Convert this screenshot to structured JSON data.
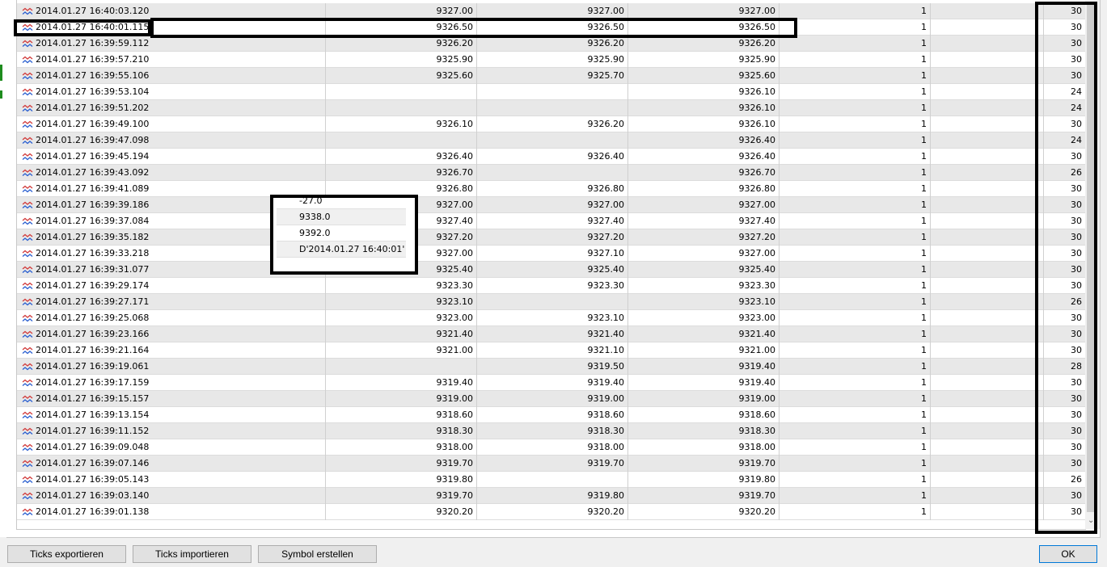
{
  "colors": {
    "row_alt": "#e8e8e8",
    "row_base": "#ffffff",
    "highlight_border": "#000000",
    "ok_border": "#0078d7",
    "tick_icon_red": "#d23c3c",
    "tick_icon_blue": "#2a5fd0"
  },
  "tick_icon": "tick-wave-icon",
  "ticks": [
    {
      "time": "2014.01.27 16:40:03.120",
      "bid": "9327.00",
      "ask": "9327.00",
      "last": "9327.00",
      "volume": "1",
      "flags": "30"
    },
    {
      "time": "2014.01.27 16:40:01.115",
      "bid": "9326.50",
      "ask": "9326.50",
      "last": "9326.50",
      "volume": "1",
      "flags": "30"
    },
    {
      "time": "2014.01.27 16:39:59.112",
      "bid": "9326.20",
      "ask": "9326.20",
      "last": "9326.20",
      "volume": "1",
      "flags": "30"
    },
    {
      "time": "2014.01.27 16:39:57.210",
      "bid": "9325.90",
      "ask": "9325.90",
      "last": "9325.90",
      "volume": "1",
      "flags": "30"
    },
    {
      "time": "2014.01.27 16:39:55.106",
      "bid": "9325.60",
      "ask": "9325.70",
      "last": "9325.60",
      "volume": "1",
      "flags": "30"
    },
    {
      "time": "2014.01.27 16:39:53.104",
      "bid": "",
      "ask": "",
      "last": "9326.10",
      "volume": "1",
      "flags": "24"
    },
    {
      "time": "2014.01.27 16:39:51.202",
      "bid": "",
      "ask": "",
      "last": "9326.10",
      "volume": "1",
      "flags": "24"
    },
    {
      "time": "2014.01.27 16:39:49.100",
      "bid": "9326.10",
      "ask": "9326.20",
      "last": "9326.10",
      "volume": "1",
      "flags": "30"
    },
    {
      "time": "2014.01.27 16:39:47.098",
      "bid": "",
      "ask": "",
      "last": "9326.40",
      "volume": "1",
      "flags": "24"
    },
    {
      "time": "2014.01.27 16:39:45.194",
      "bid": "9326.40",
      "ask": "9326.40",
      "last": "9326.40",
      "volume": "1",
      "flags": "30"
    },
    {
      "time": "2014.01.27 16:39:43.092",
      "bid": "9326.70",
      "ask": "",
      "last": "9326.70",
      "volume": "1",
      "flags": "26"
    },
    {
      "time": "2014.01.27 16:39:41.089",
      "bid": "9326.80",
      "ask": "9326.80",
      "last": "9326.80",
      "volume": "1",
      "flags": "30"
    },
    {
      "time": "2014.01.27 16:39:39.186",
      "bid": "9327.00",
      "ask": "9327.00",
      "last": "9327.00",
      "volume": "1",
      "flags": "30"
    },
    {
      "time": "2014.01.27 16:39:37.084",
      "bid": "9327.40",
      "ask": "9327.40",
      "last": "9327.40",
      "volume": "1",
      "flags": "30"
    },
    {
      "time": "2014.01.27 16:39:35.182",
      "bid": "9327.20",
      "ask": "9327.20",
      "last": "9327.20",
      "volume": "1",
      "flags": "30"
    },
    {
      "time": "2014.01.27 16:39:33.218",
      "bid": "9327.00",
      "ask": "9327.10",
      "last": "9327.00",
      "volume": "1",
      "flags": "30"
    },
    {
      "time": "2014.01.27 16:39:31.077",
      "bid": "9325.40",
      "ask": "9325.40",
      "last": "9325.40",
      "volume": "1",
      "flags": "30"
    },
    {
      "time": "2014.01.27 16:39:29.174",
      "bid": "9323.30",
      "ask": "9323.30",
      "last": "9323.30",
      "volume": "1",
      "flags": "30"
    },
    {
      "time": "2014.01.27 16:39:27.171",
      "bid": "9323.10",
      "ask": "",
      "last": "9323.10",
      "volume": "1",
      "flags": "26"
    },
    {
      "time": "2014.01.27 16:39:25.068",
      "bid": "9323.00",
      "ask": "9323.10",
      "last": "9323.00",
      "volume": "1",
      "flags": "30"
    },
    {
      "time": "2014.01.27 16:39:23.166",
      "bid": "9321.40",
      "ask": "9321.40",
      "last": "9321.40",
      "volume": "1",
      "flags": "30"
    },
    {
      "time": "2014.01.27 16:39:21.164",
      "bid": "9321.00",
      "ask": "9321.10",
      "last": "9321.00",
      "volume": "1",
      "flags": "30"
    },
    {
      "time": "2014.01.27 16:39:19.061",
      "bid": "",
      "ask": "9319.50",
      "last": "9319.40",
      "volume": "1",
      "flags": "28"
    },
    {
      "time": "2014.01.27 16:39:17.159",
      "bid": "9319.40",
      "ask": "9319.40",
      "last": "9319.40",
      "volume": "1",
      "flags": "30"
    },
    {
      "time": "2014.01.27 16:39:15.157",
      "bid": "9319.00",
      "ask": "9319.00",
      "last": "9319.00",
      "volume": "1",
      "flags": "30"
    },
    {
      "time": "2014.01.27 16:39:13.154",
      "bid": "9318.60",
      "ask": "9318.60",
      "last": "9318.60",
      "volume": "1",
      "flags": "30"
    },
    {
      "time": "2014.01.27 16:39:11.152",
      "bid": "9318.30",
      "ask": "9318.30",
      "last": "9318.30",
      "volume": "1",
      "flags": "30"
    },
    {
      "time": "2014.01.27 16:39:09.048",
      "bid": "9318.00",
      "ask": "9318.00",
      "last": "9318.00",
      "volume": "1",
      "flags": "30"
    },
    {
      "time": "2014.01.27 16:39:07.146",
      "bid": "9319.70",
      "ask": "9319.70",
      "last": "9319.70",
      "volume": "1",
      "flags": "30"
    },
    {
      "time": "2014.01.27 16:39:05.143",
      "bid": "9319.80",
      "ask": "",
      "last": "9319.80",
      "volume": "1",
      "flags": "26"
    },
    {
      "time": "2014.01.27 16:39:03.140",
      "bid": "9319.70",
      "ask": "9319.80",
      "last": "9319.70",
      "volume": "1",
      "flags": "30"
    },
    {
      "time": "2014.01.27 16:39:01.138",
      "bid": "9320.20",
      "ask": "9320.20",
      "last": "9320.20",
      "volume": "1",
      "flags": "30"
    }
  ],
  "popup": {
    "items": [
      "-27.0",
      "9338.0",
      "9392.0",
      "D'2014.01.27 16:40:01'"
    ]
  },
  "buttons": {
    "export": "Ticks exportieren",
    "import": "Ticks importieren",
    "create_symbol": "Symbol erstellen",
    "ok": "OK"
  }
}
